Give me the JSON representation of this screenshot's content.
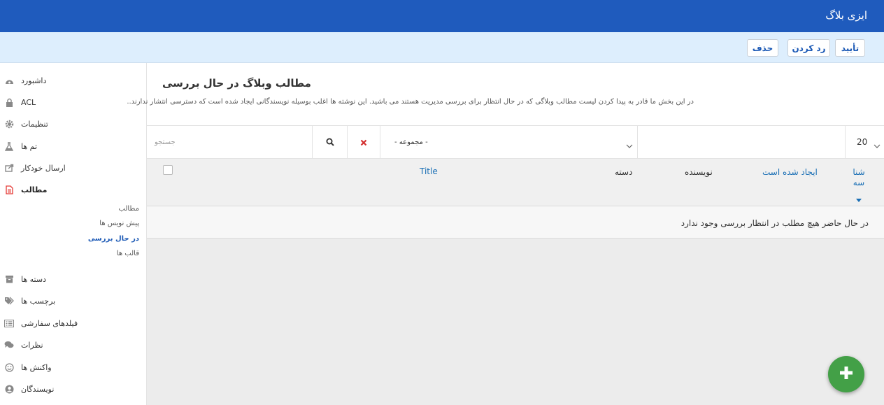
{
  "app": {
    "brand": "ایزی بلاگ"
  },
  "toolbar": {
    "approve": "تأیید",
    "reject": "رد کردن",
    "delete": "حذف"
  },
  "sidebar": {
    "items": [
      {
        "label": "داشبورد",
        "icon": "dashboard-icon"
      },
      {
        "label": "ACL",
        "icon": "lock-icon"
      },
      {
        "label": "تنظیمات",
        "icon": "gear-icon"
      },
      {
        "label": "تم ها",
        "icon": "flask-icon"
      },
      {
        "label": "ارسال خودکار",
        "icon": "share-icon"
      },
      {
        "label": "مطالب",
        "icon": "document-icon",
        "active": true
      },
      {
        "label": "دسته ها",
        "icon": "archive-icon"
      },
      {
        "label": "برچسب ها",
        "icon": "tags-icon"
      },
      {
        "label": "فیلدهای سفارشی",
        "icon": "list-icon"
      },
      {
        "label": "نظرات",
        "icon": "comments-icon"
      },
      {
        "label": "واکنش ها",
        "icon": "smile-icon"
      },
      {
        "label": "نویسندگان",
        "icon": "user-icon"
      }
    ],
    "subitems": [
      {
        "label": "مطالب",
        "active": false
      },
      {
        "label": "پیش نویس ها",
        "active": false
      },
      {
        "label": "در حال بررسی",
        "active": true
      },
      {
        "label": "قالب ها",
        "active": false
      }
    ]
  },
  "page": {
    "title": "مطالب وبلاگ در حال بررسی",
    "description": "در این بخش ما قادر به پیدا کردن لیست مطالب وبلاگی که در حال انتظار برای بررسی مدیریت هستند می باشید. این نوشته ها اغلب بوسیله نویسندگانی ایجاد شده است که دسترسی انتشار ندارند.."
  },
  "filters": {
    "search_placeholder": "جستجو",
    "category_value": "- مجموعه -",
    "per_page": "20"
  },
  "table": {
    "columns": {
      "id": "شنا سه",
      "created": "ایجاد شده است",
      "author": "نویسنده",
      "category": "دسته",
      "title": "Title"
    },
    "empty_message": "در حال حاضر هیچ مطلب در انتظار بررسی وجود ندارد"
  },
  "colors": {
    "header": "#1f5bbd",
    "toolbar": "#ddeefd",
    "accent": "#1a58b5",
    "fab": "#43a047"
  }
}
